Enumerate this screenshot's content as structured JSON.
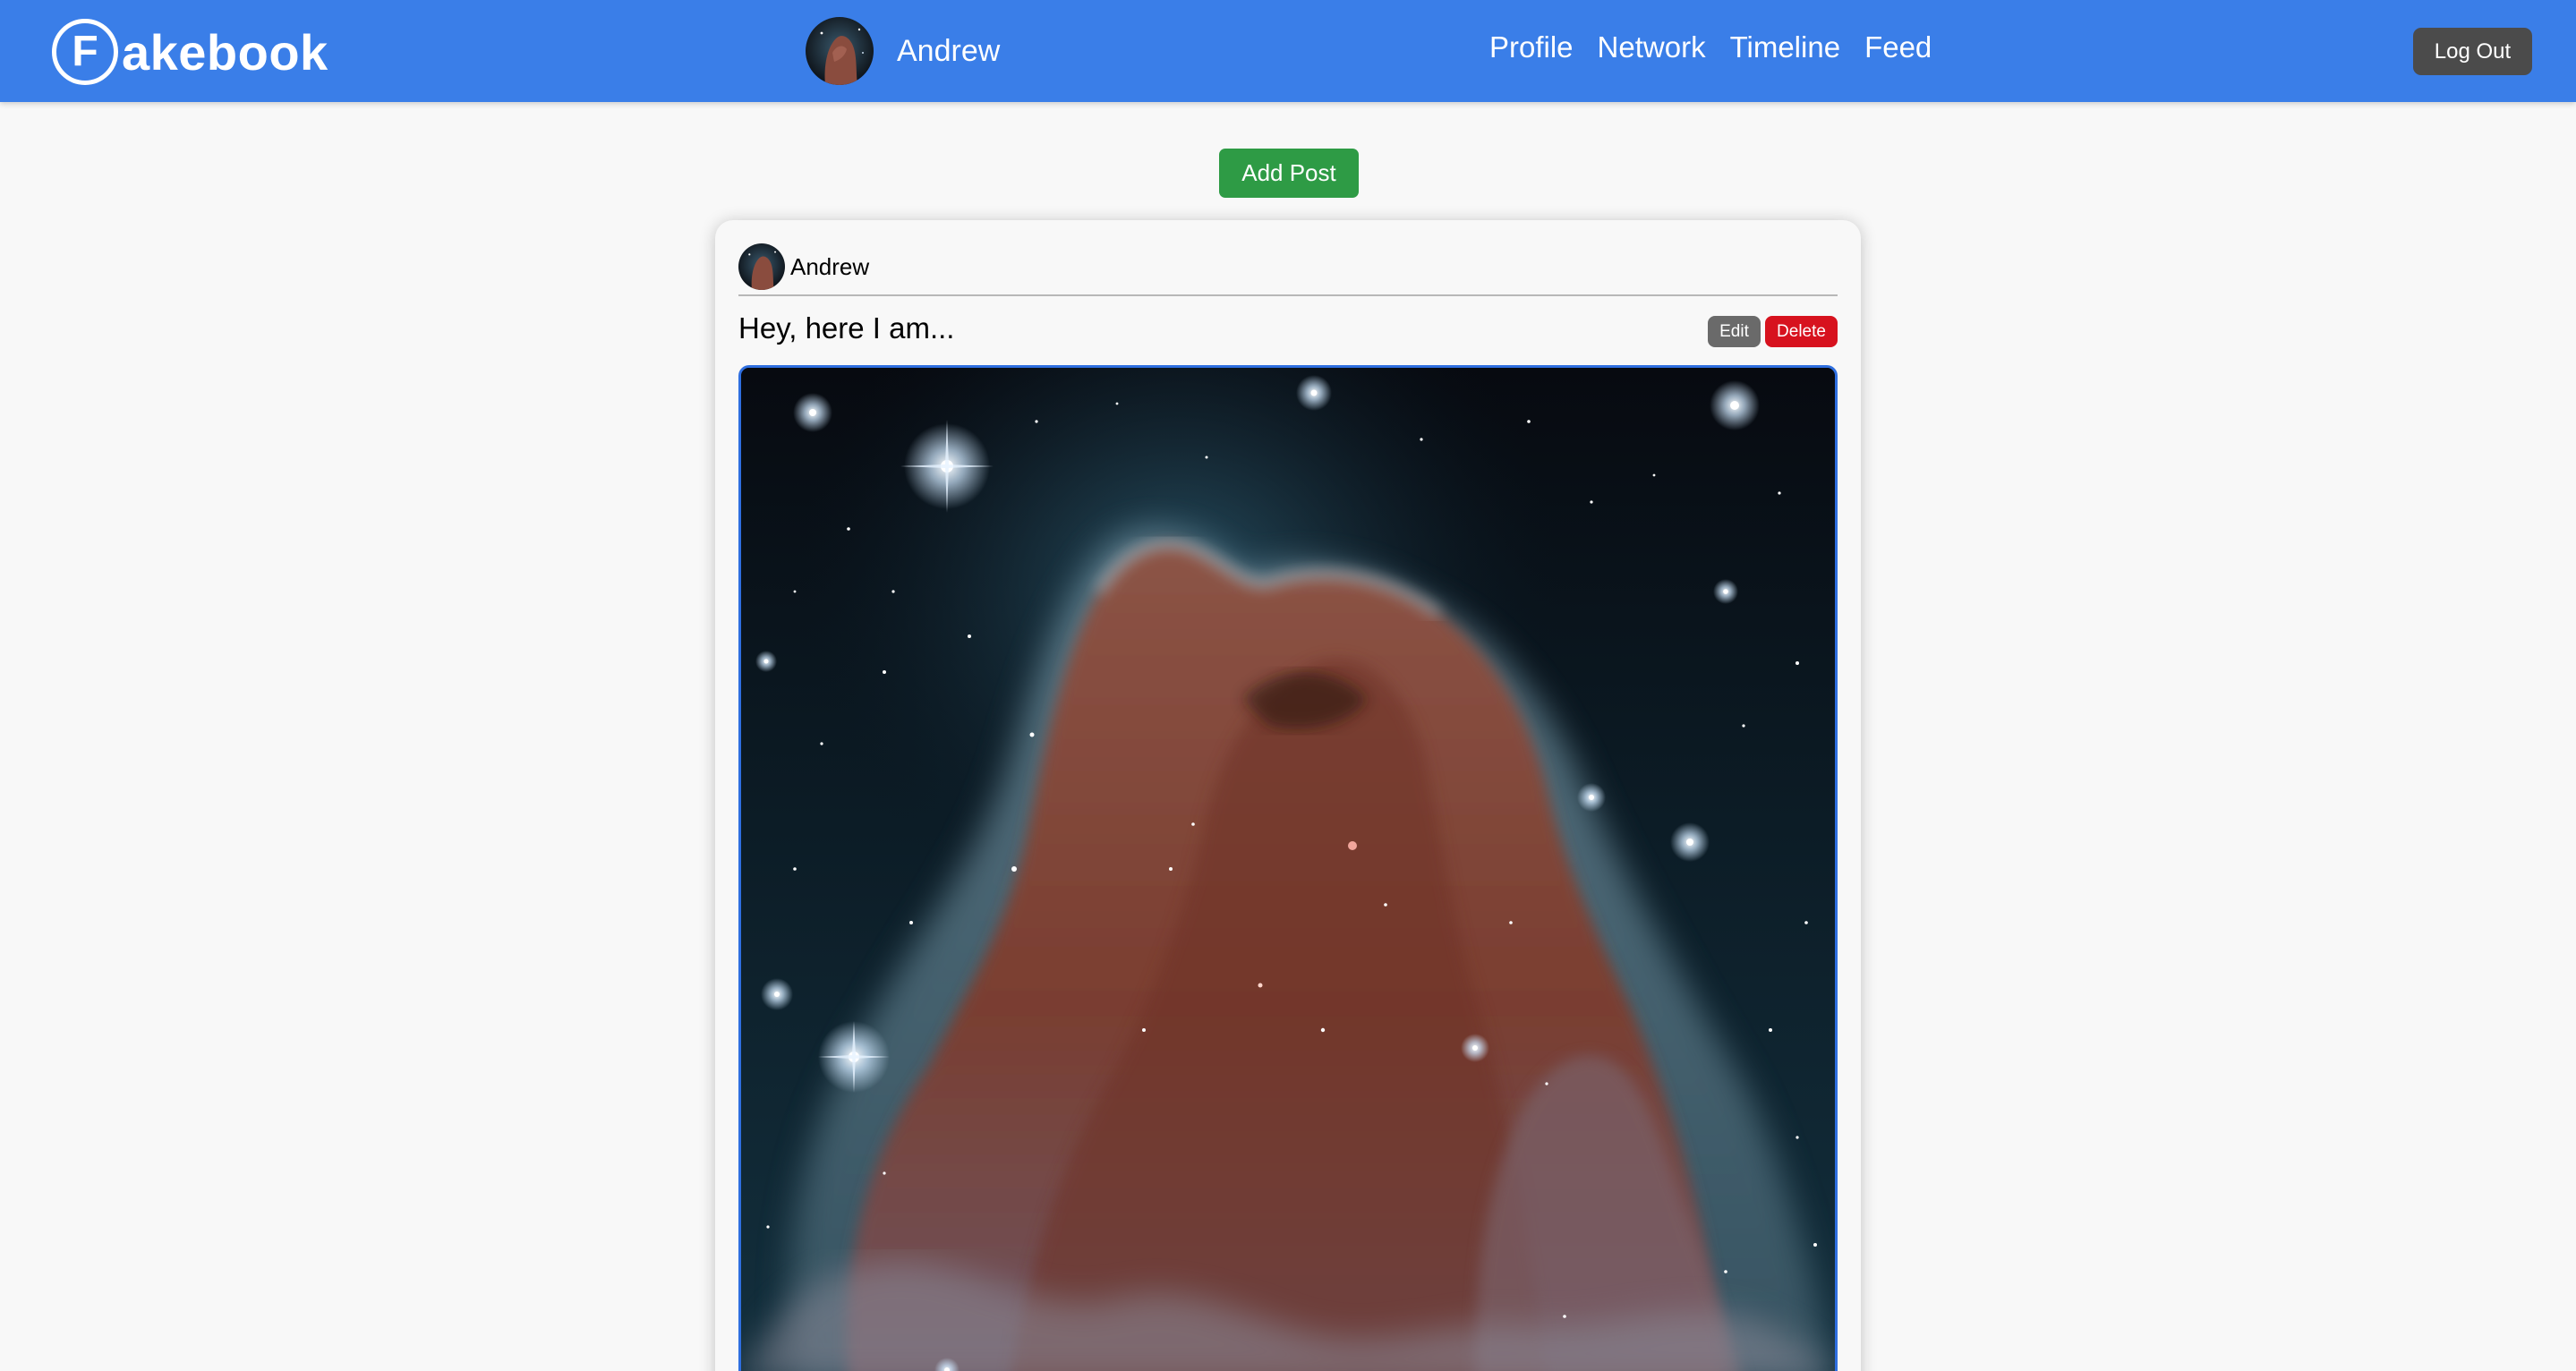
{
  "navbar": {
    "brand_letter": "F",
    "brand_text": "akebook",
    "username": "Andrew",
    "links": [
      "Profile",
      "Network",
      "Timeline",
      "Feed"
    ],
    "logout_label": "Log Out",
    "background_color": "#3a7ee8"
  },
  "actions": {
    "add_post_label": "Add Post",
    "add_post_color": "#2e9b45"
  },
  "post": {
    "author": "Andrew",
    "caption": "Hey, here I am...",
    "edit_label": "Edit",
    "delete_label": "Delete",
    "edit_color": "#6a6a6a",
    "delete_color": "#d7121e",
    "image_subject": "horsehead-nebula"
  }
}
